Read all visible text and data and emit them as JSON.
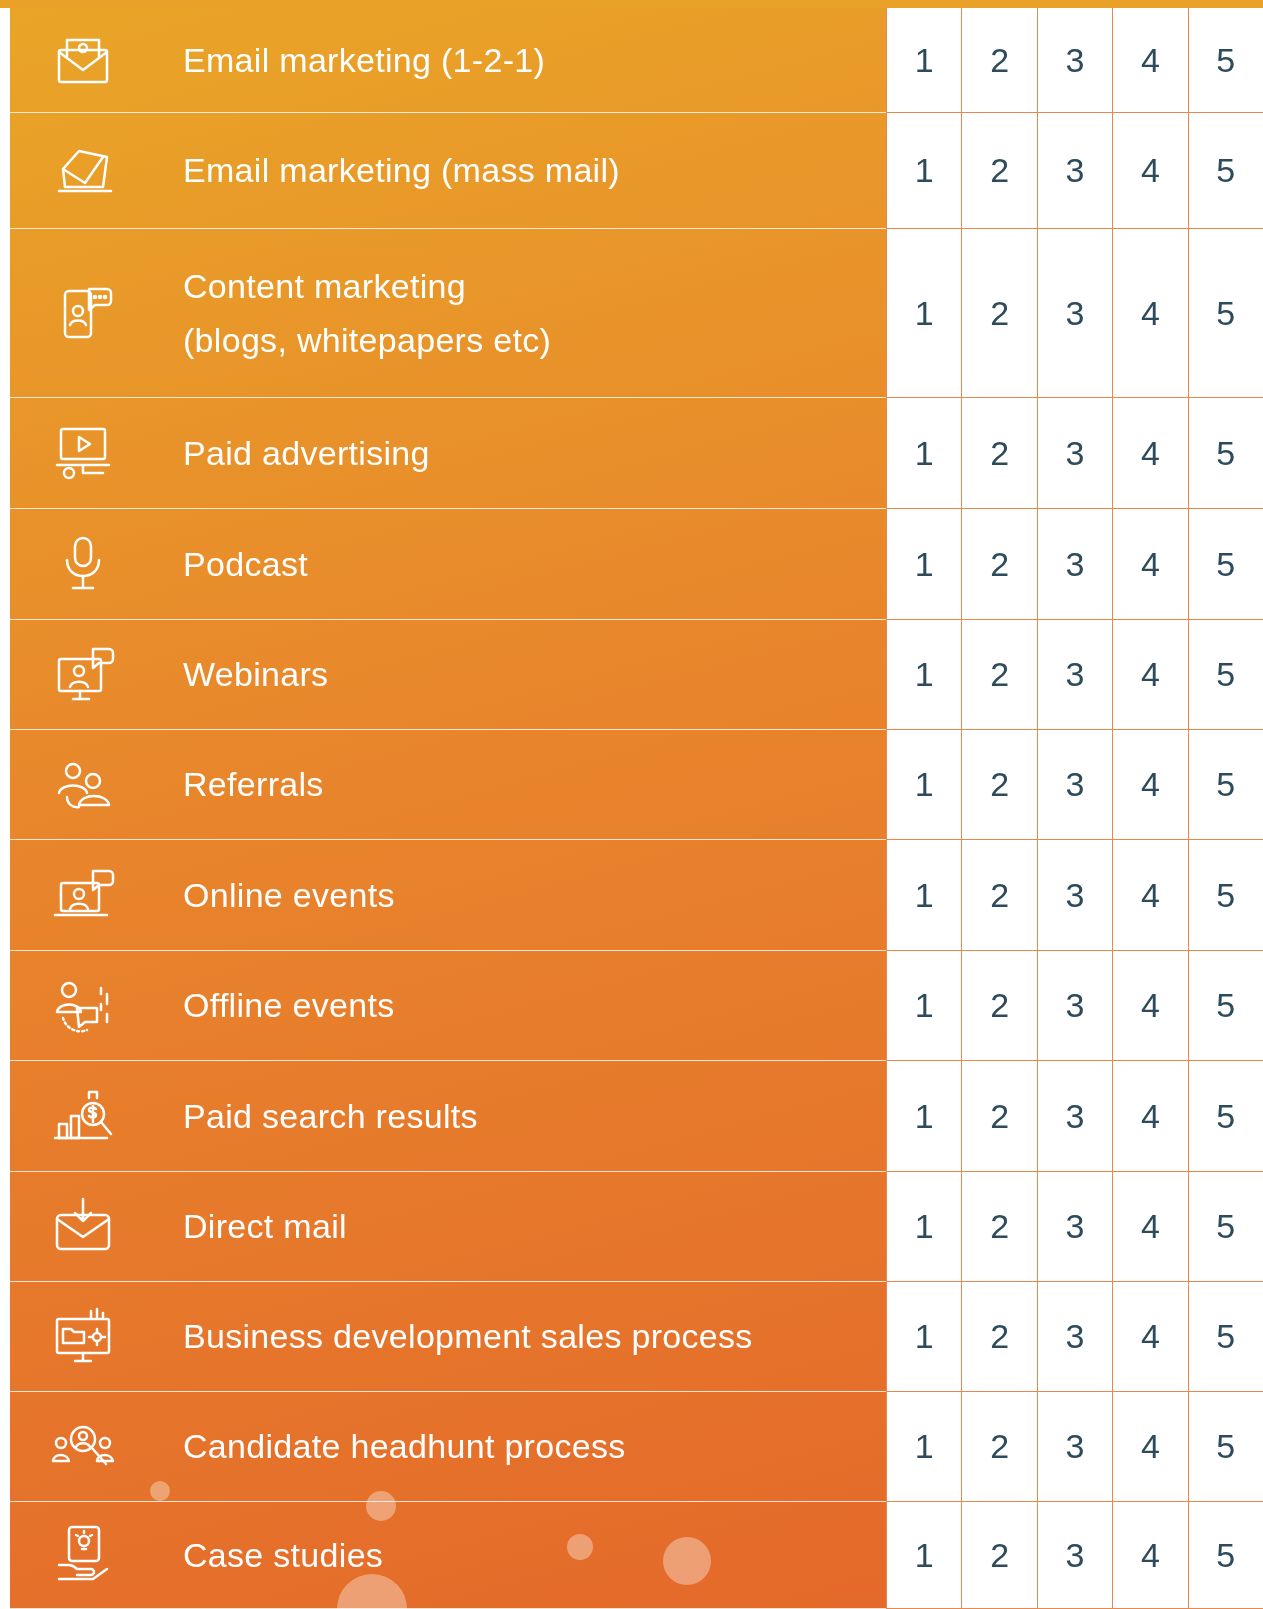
{
  "rows": [
    {
      "label": "Email marketing (1-2-1)",
      "ratings": [
        "1",
        "2",
        "3",
        "4",
        "5"
      ]
    },
    {
      "label": "Email marketing (mass mail)",
      "ratings": [
        "1",
        "2",
        "3",
        "4",
        "5"
      ]
    },
    {
      "label": "Content marketing\n(blogs, whitepapers etc)",
      "ratings": [
        "1",
        "2",
        "3",
        "4",
        "5"
      ]
    },
    {
      "label": "Paid advertising",
      "ratings": [
        "1",
        "2",
        "3",
        "4",
        "5"
      ]
    },
    {
      "label": "Podcast",
      "ratings": [
        "1",
        "2",
        "3",
        "4",
        "5"
      ]
    },
    {
      "label": "Webinars",
      "ratings": [
        "1",
        "2",
        "3",
        "4",
        "5"
      ]
    },
    {
      "label": "Referrals",
      "ratings": [
        "1",
        "2",
        "3",
        "4",
        "5"
      ]
    },
    {
      "label": "Online events",
      "ratings": [
        "1",
        "2",
        "3",
        "4",
        "5"
      ]
    },
    {
      "label": "Offline events",
      "ratings": [
        "1",
        "2",
        "3",
        "4",
        "5"
      ]
    },
    {
      "label": "Paid search results",
      "ratings": [
        "1",
        "2",
        "3",
        "4",
        "5"
      ]
    },
    {
      "label": "Direct mail",
      "ratings": [
        "1",
        "2",
        "3",
        "4",
        "5"
      ]
    },
    {
      "label": "Business development sales process",
      "ratings": [
        "1",
        "2",
        "3",
        "4",
        "5"
      ]
    },
    {
      "label": "Candidate headhunt process",
      "ratings": [
        "1",
        "2",
        "3",
        "4",
        "5"
      ]
    },
    {
      "label": "Case studies",
      "ratings": [
        "1",
        "2",
        "3",
        "4",
        "5"
      ]
    }
  ]
}
